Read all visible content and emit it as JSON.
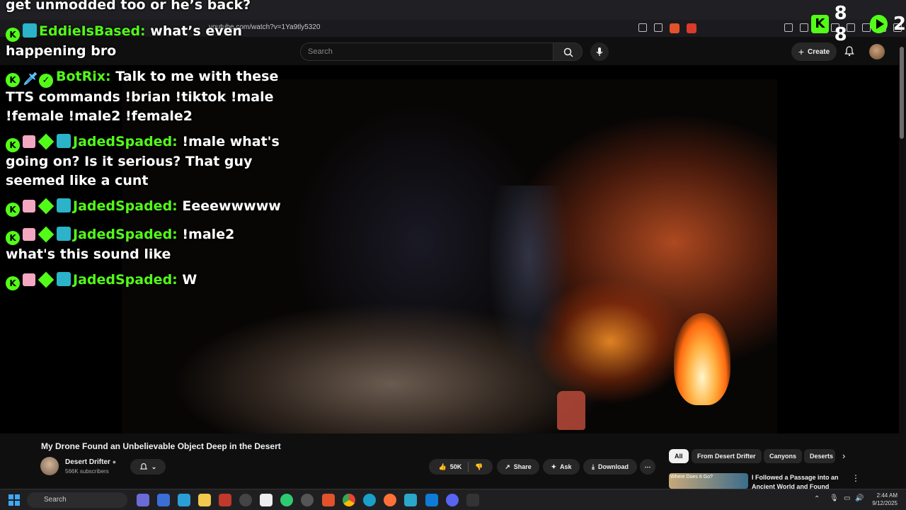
{
  "browser": {
    "url": "youtube.com/watch?v=1Ya9tly5320"
  },
  "youtube": {
    "search_placeholder": "Search",
    "create_label": "Create"
  },
  "overlay": {
    "kick_count_1": "8 8",
    "kick_count_2": "2",
    "chat": [
      {
        "text": "get unmodded too or he’s back?"
      },
      {
        "user": "EddieIsBased:",
        "text": " what’s even happening bro"
      },
      {
        "user": "BotRix:",
        "text": " Talk to me with these TTS commands !brian !tiktok !male !female !male2 !female2"
      },
      {
        "user": "JadedSpaded:",
        "text": " !male what's going on? Is it serious? That guy seemed like a cunt"
      },
      {
        "user": "JadedSpaded:",
        "text": " Eeeewwwww"
      },
      {
        "user": "JadedSpaded:",
        "text": " !male2 what's this sound like"
      },
      {
        "user": "JadedSpaded:",
        "text": " W"
      }
    ]
  },
  "video": {
    "title": "My Drone Found an Unbelievable Object Deep in the Desert",
    "channel": "Desert Drifter",
    "subscribers": "566K subscribers",
    "likes": "50K",
    "share": "Share",
    "ask": "Ask",
    "download": "Download"
  },
  "chips": [
    "All",
    "From Desert Drifter",
    "Canyons",
    "Deserts"
  ],
  "recommendation": {
    "title": "I Followed a Passage into an Ancient World and Found This",
    "thumb_text": "Where Does It Go?"
  },
  "taskbar": {
    "search": "Search",
    "time": "2:44 AM",
    "date": "9/12/2025"
  }
}
